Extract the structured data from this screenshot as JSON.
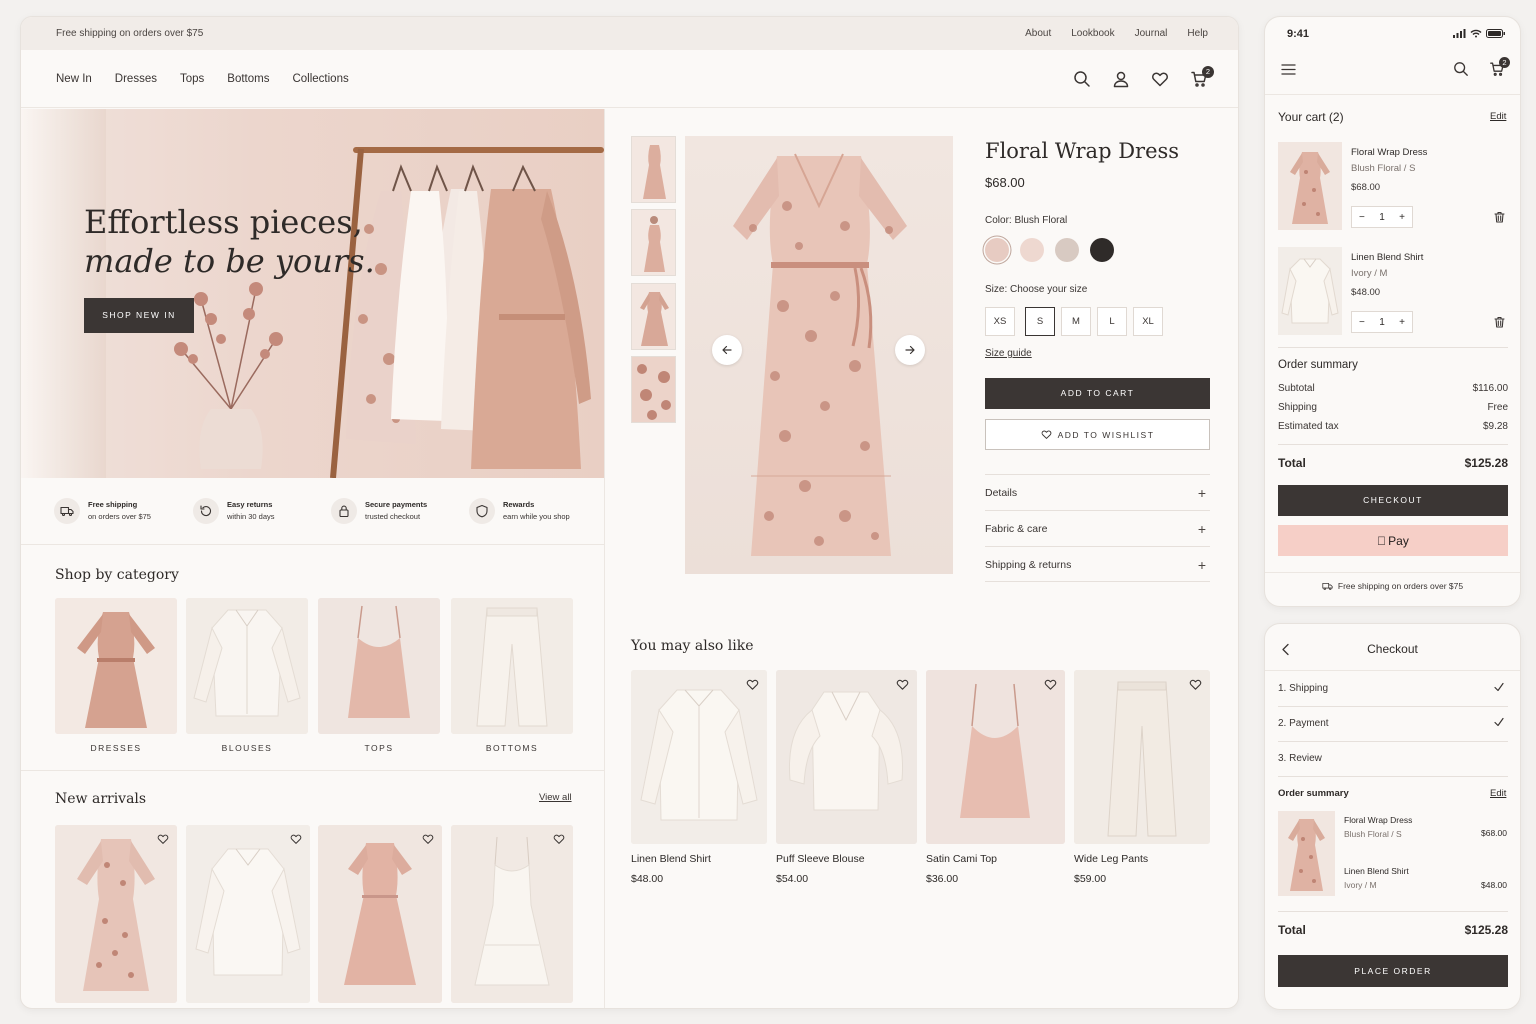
{
  "colors": {
    "accent_dark": "#3b3634",
    "apple_pay_bg": "#f6cfc7",
    "page_bg": "#fbf9f7"
  },
  "topbar": {
    "promo": "Free shipping on orders over $75",
    "links": [
      "About",
      "Lookbook",
      "Journal",
      "Help"
    ]
  },
  "nav": {
    "items": [
      "New In",
      "Dresses",
      "Tops",
      "Bottoms",
      "Collections"
    ],
    "cart_count": "2",
    "icons": [
      "search-icon",
      "user-icon",
      "heart-icon",
      "cart-icon"
    ]
  },
  "hero": {
    "line1": "Effortless pieces,",
    "line2": "made to be yours.",
    "cta": "SHOP NEW IN"
  },
  "features": [
    {
      "title": "Free shipping",
      "sub": "on orders over $75",
      "icon": "truck-icon"
    },
    {
      "title": "Easy returns",
      "sub": "within 30 days",
      "icon": "returns-icon"
    },
    {
      "title": "Secure payments",
      "sub": "trusted checkout",
      "icon": "lock-icon"
    },
    {
      "title": "Rewards",
      "sub": "earn while you shop",
      "icon": "shield-icon"
    }
  ],
  "categories": {
    "title": "Shop by category",
    "items": [
      "DRESSES",
      "BLOUSES",
      "TOPS",
      "BOTTOMS"
    ]
  },
  "new_arrivals": {
    "title": "New arrivals",
    "view_all": "View all"
  },
  "product": {
    "title": "Floral Wrap Dress",
    "price": "$68.00",
    "color_label": "Color:",
    "color_value": "Blush Floral",
    "size_label": "Size:",
    "size_hint": "Choose your size",
    "sizes": [
      "XS",
      "S",
      "M",
      "L",
      "XL"
    ],
    "selected_size": "S",
    "size_guide": "Size guide",
    "add_to_cart": "ADD TO CART",
    "add_to_wishlist": "ADD TO WISHLIST",
    "accordion": [
      "Details",
      "Fabric & care",
      "Shipping & returns"
    ],
    "swatches": [
      "#e7cbc2",
      "#eed8d0",
      "#d8cac2",
      "#2f2b29"
    ]
  },
  "recommendations": {
    "title": "You may also like",
    "items": [
      {
        "name": "Linen Blend Shirt",
        "price": "$48.00"
      },
      {
        "name": "Puff Sleeve Blouse",
        "price": "$54.00"
      },
      {
        "name": "Satin Cami Top",
        "price": "$36.00"
      },
      {
        "name": "Wide Leg Pants",
        "price": "$59.00"
      }
    ]
  },
  "mobile_cart": {
    "time": "9:41",
    "cart_count": "2",
    "title": "Your cart (2)",
    "edit": "Edit",
    "items": [
      {
        "name": "Floral Wrap Dress",
        "variant": "Blush Floral / S",
        "price": "$68.00",
        "qty": "1"
      },
      {
        "name": "Linen Blend Shirt",
        "variant": "Ivory / M",
        "price": "$48.00",
        "qty": "1"
      }
    ],
    "summary_title": "Order summary",
    "subtotal_label": "Subtotal",
    "subtotal": "$116.00",
    "shipping_label": "Shipping",
    "shipping": "Free",
    "tax_label": "Estimated tax",
    "tax": "$9.28",
    "total_label": "Total",
    "total": "$125.28",
    "checkout": "CHECKOUT",
    "apple_pay": "Pay",
    "shipping_note": "Free shipping on orders over $75"
  },
  "mobile_checkout": {
    "title": "Checkout",
    "steps": [
      "1. Shipping",
      "2. Payment",
      "3. Review"
    ],
    "summary_title": "Order summary",
    "edit": "Edit",
    "items": [
      {
        "name": "Floral Wrap Dress",
        "variant": "Blush Floral  /  S",
        "price": "$68.00"
      },
      {
        "name": "Linen Blend Shirt",
        "variant": "Ivory / M",
        "price": "$48.00"
      }
    ],
    "total_label": "Total",
    "total": "$125.28",
    "place_order": "PLACE ORDER"
  }
}
